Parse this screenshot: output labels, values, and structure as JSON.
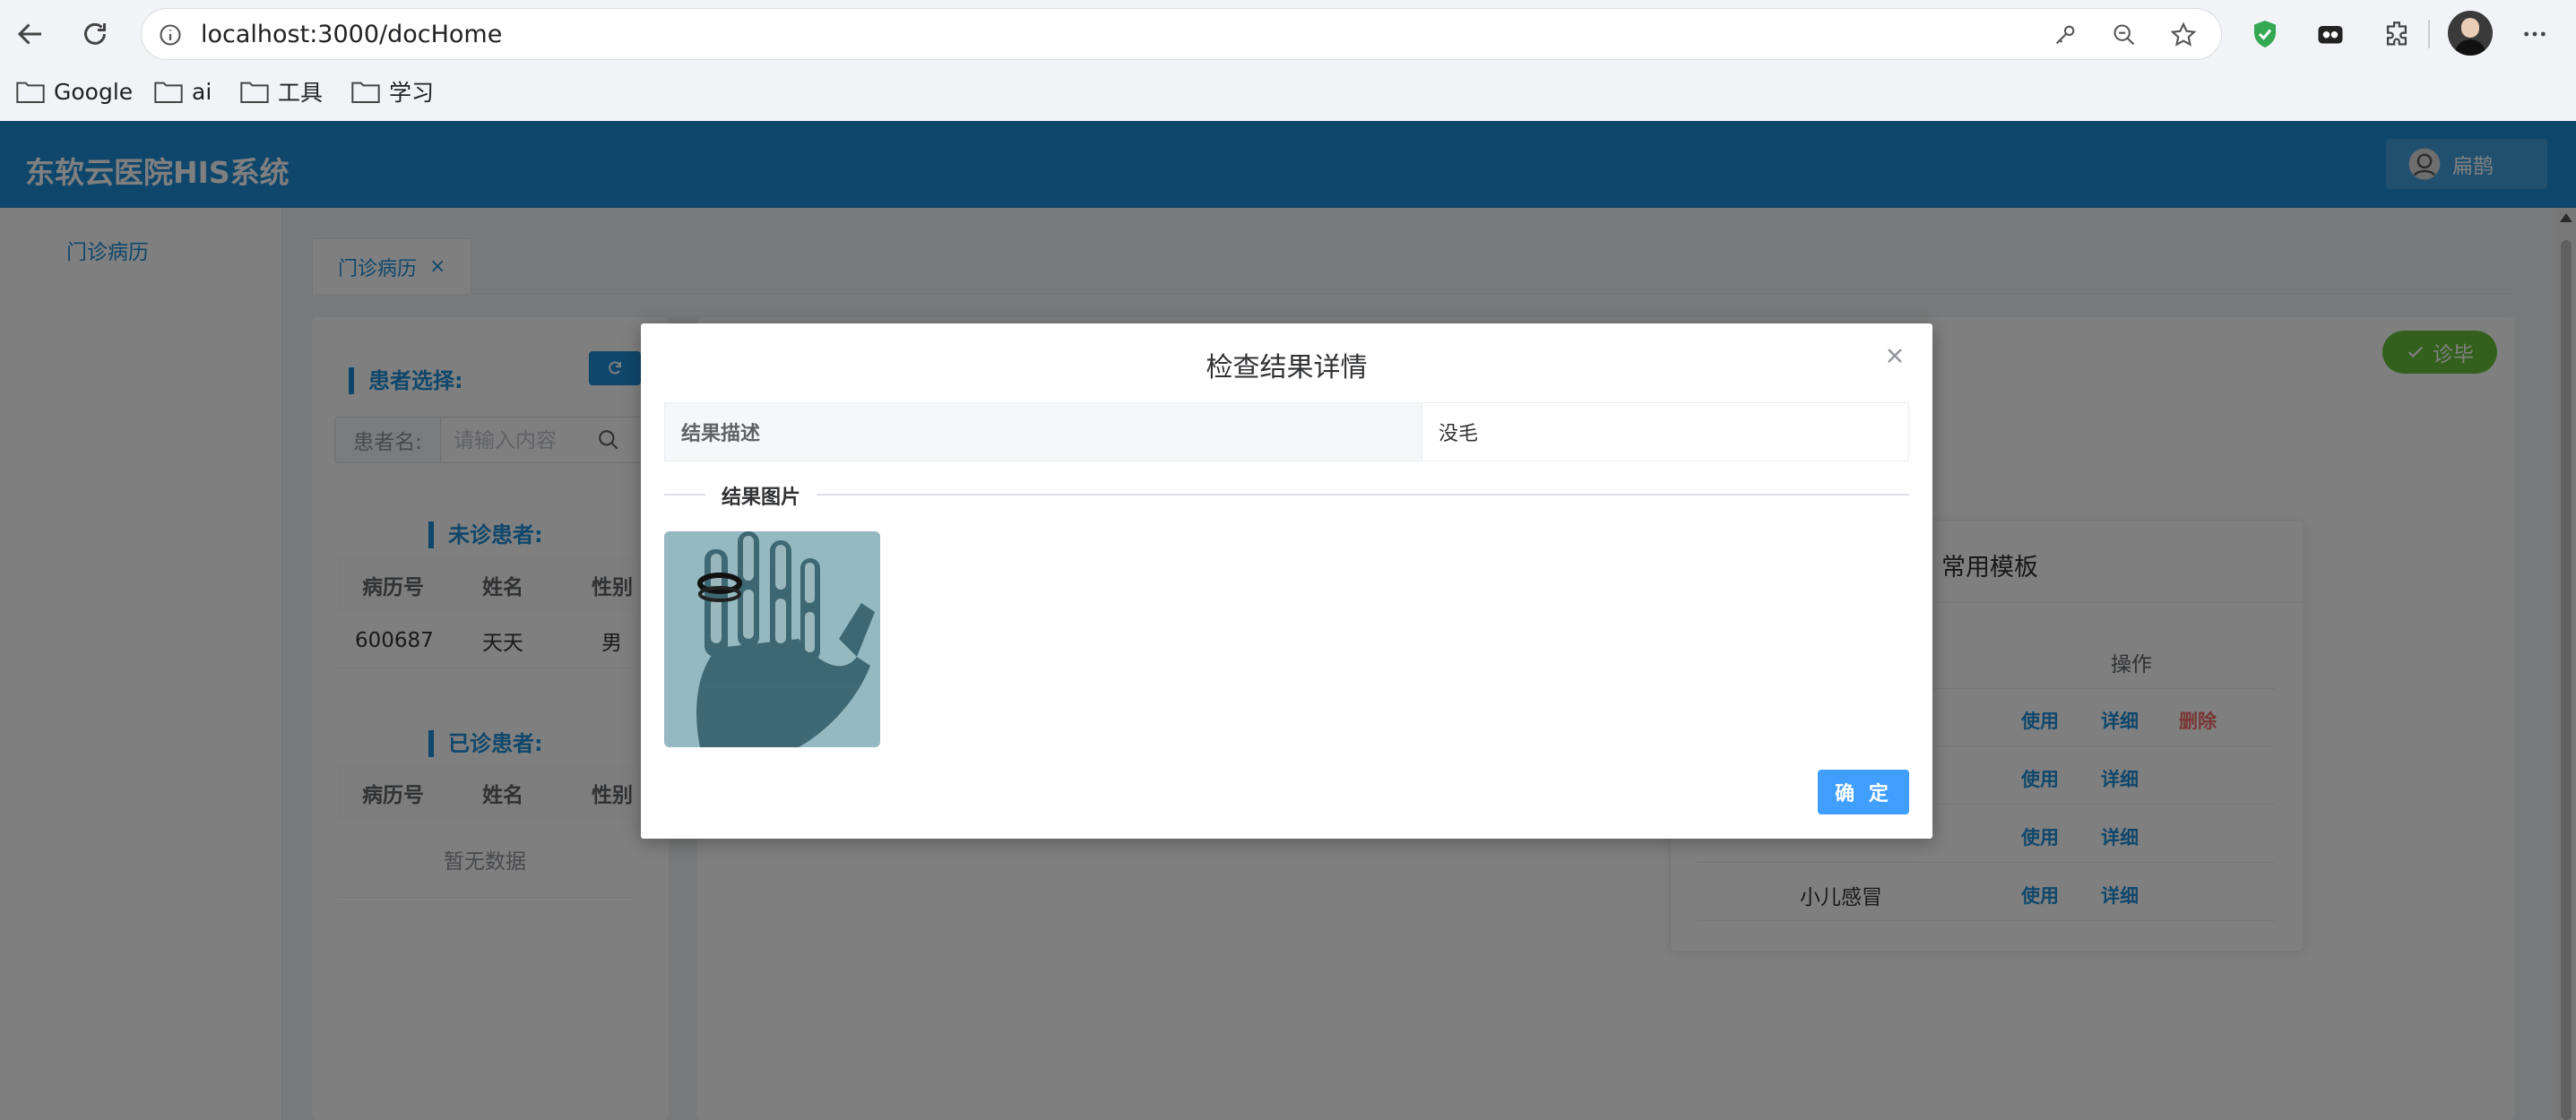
{
  "browser": {
    "url": "localhost:3000/docHome",
    "bookmarks": [
      {
        "label": "Google"
      },
      {
        "label": "ai"
      },
      {
        "label": "工具"
      },
      {
        "label": "学习"
      }
    ]
  },
  "app": {
    "title": "东软云医院HIS系统",
    "user_name": "扁鹊"
  },
  "sidebar": {
    "items": [
      {
        "label": "门诊病历"
      }
    ]
  },
  "tabs": [
    {
      "label": "门诊病历",
      "close": "×"
    }
  ],
  "patient_panel": {
    "title": "患者选择:",
    "search_prefix": "患者名:",
    "search_placeholder": "请输入内容",
    "undiagnosed": {
      "title": "未诊患者:",
      "columns": [
        "病历号",
        "姓名",
        "性别"
      ],
      "rows": [
        [
          "600687",
          "天天",
          "男"
        ]
      ]
    },
    "diagnosed": {
      "title": "已诊患者:",
      "columns": [
        "病历号",
        "姓名",
        "性别"
      ],
      "empty_text": "暂无数据"
    }
  },
  "main": {
    "finish_label": "诊毕"
  },
  "templates": {
    "title": "常用模板",
    "op_column": "操作",
    "rows": [
      {
        "name": "",
        "actions": [
          "使用",
          "详细",
          "删除"
        ]
      },
      {
        "name": "",
        "actions": [
          "使用",
          "详细"
        ]
      },
      {
        "name": "",
        "actions": [
          "使用",
          "详细"
        ]
      },
      {
        "name": "小儿感冒",
        "actions": [
          "使用",
          "详细"
        ]
      }
    ]
  },
  "dialog": {
    "title": "检查结果详情",
    "desc_label": "结果描述",
    "desc_value": "没毛",
    "image_section": "结果图片",
    "confirm_label": "确 定"
  },
  "colors": {
    "header": "#1e8ed8",
    "primary": "#409eff",
    "success": "#67c23a",
    "danger": "#f56c6c"
  }
}
